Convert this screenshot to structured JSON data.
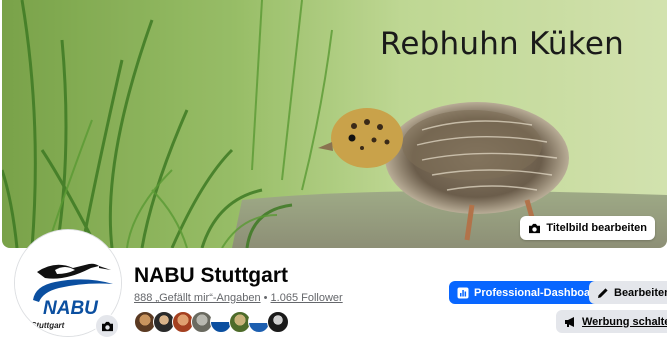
{
  "cover": {
    "title_text": "Rebhuhn Küken",
    "edit_button_label": "Titelbild bearbeiten"
  },
  "profile": {
    "logo_text": "NABU",
    "logo_subtext": "Stuttgart",
    "page_name": "NABU Stuttgart",
    "likes": "888 „Gefällt mir“-Angaben",
    "separator": " • ",
    "followers": "1.065 Follower"
  },
  "actions": {
    "dashboard_label": "Professional-Dashboard",
    "edit_label": "Bearbeiten",
    "ads_label": "Werbung schalten"
  },
  "friends": {
    "count_shown": 8
  },
  "colors": {
    "primary": "#0866ff",
    "button_grey": "#e4e6eb",
    "nabu_blue": "#0b4fa0"
  }
}
